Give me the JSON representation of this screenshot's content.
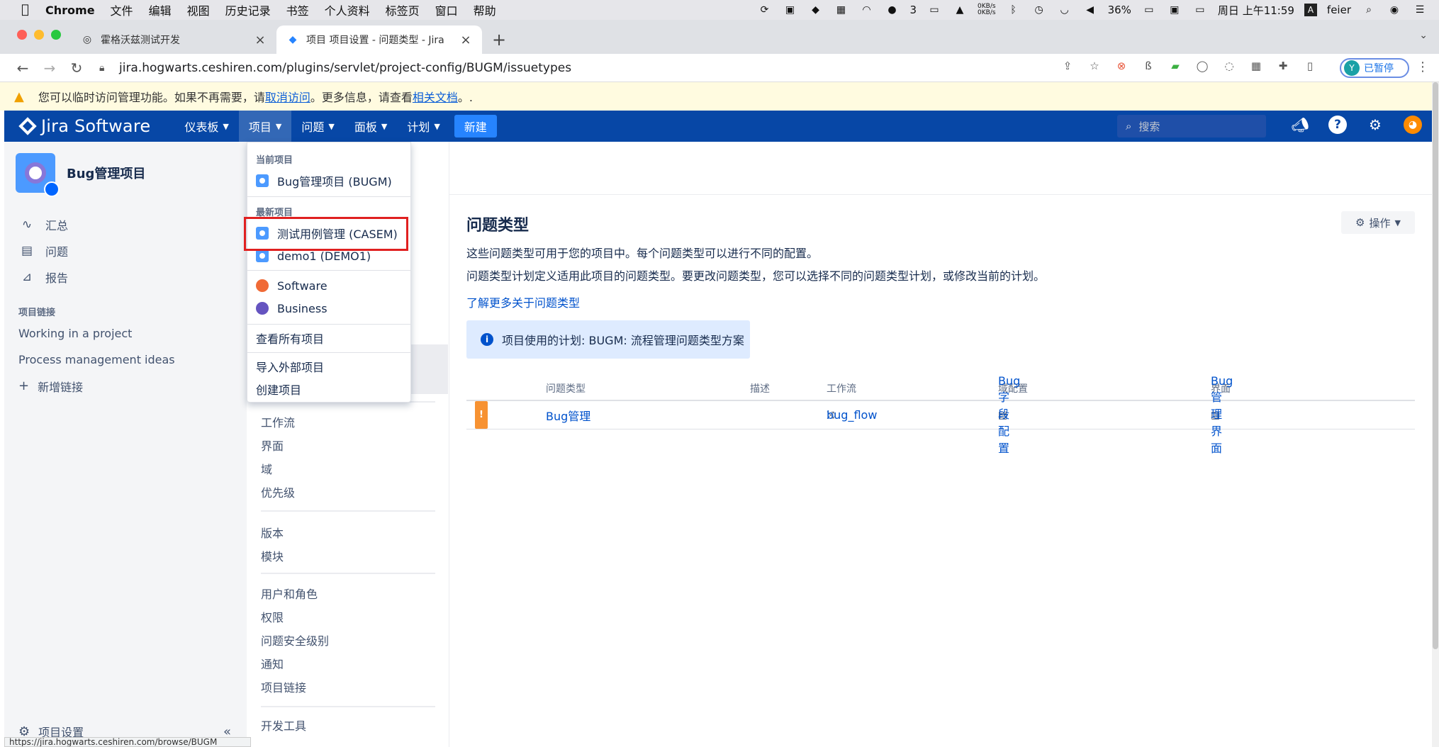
{
  "macbar": {
    "app": "Chrome",
    "menus": [
      "文件",
      "编辑",
      "视图",
      "历史记录",
      "书签",
      "个人资料",
      "标签页",
      "窗口",
      "帮助"
    ],
    "net_up": "0KB/s",
    "net_down": "0KB/s",
    "wechat_count": "3",
    "battery": "36%",
    "clock": "周日 上午11:59",
    "user": "feier"
  },
  "tabs": [
    {
      "title": "霍格沃兹测试开发"
    },
    {
      "title": "项目 项目设置 - 问题类型 - Jira"
    }
  ],
  "address": {
    "url": "jira.hogwarts.ceshiren.com/plugins/servlet/project-config/BUGM/issuetypes",
    "profile_initial": "Y",
    "profile_label": "已暂停"
  },
  "banner": {
    "text1": "您可以临时访问管理功能。如果不再需要，请",
    "link1": "取消访问",
    "text2": "。更多信息，请查看",
    "link2": "相关文档",
    "text3": "。."
  },
  "jira": {
    "logo": "Jira Software",
    "nav": [
      {
        "label": "仪表板"
      },
      {
        "label": "项目"
      },
      {
        "label": "问题"
      },
      {
        "label": "面板"
      },
      {
        "label": "计划"
      }
    ],
    "create_label": "新建",
    "search_placeholder": "搜索"
  },
  "sidebar": {
    "project_name": "Bug管理项目",
    "nav": [
      {
        "label": "汇总"
      },
      {
        "label": "问题"
      },
      {
        "label": "报告"
      }
    ],
    "links_title": "项目链接",
    "links": [
      {
        "label": "Working in a project"
      },
      {
        "label": "Process management ideas"
      }
    ],
    "add_link_label": "新增链接",
    "footer_label": "项目设置"
  },
  "settings": {
    "group1": [
      "工作流",
      "界面",
      "域",
      "优先级"
    ],
    "group2": [
      "版本",
      "模块"
    ],
    "group3": [
      "用户和角色",
      "权限",
      "问题安全级别",
      "通知",
      "项目链接"
    ],
    "group4": [
      "开发工具"
    ]
  },
  "dropdown": {
    "current_title": "当前项目",
    "current_project": "Bug管理项目 (BUGM)",
    "recent_title": "最新项目",
    "recent": [
      {
        "label": "测试用例管理 (CASEM)"
      },
      {
        "label": "demo1 (DEMO1)"
      }
    ],
    "types": [
      {
        "label": "Software",
        "color": "#f06a36"
      },
      {
        "label": "Business",
        "color": "#6554c0"
      }
    ],
    "view_all": "查看所有项目",
    "import": "导入外部项目",
    "create": "创建项目"
  },
  "main": {
    "title": "问题类型",
    "actions_label": "操作",
    "desc1": "这些问题类型可用于您的项目中。每个问题类型可以进行不同的配置。",
    "desc2": "问题类型计划定义适用此项目的问题类型。要更改问题类型，您可以选择不同的问题类型计划，或修改当前的计划。",
    "learn_more": "了解更多关于问题类型",
    "scheme_info": "项目使用的计划: BUGM: 流程管理问题类型方案",
    "columns": [
      "问题类型",
      "描述",
      "工作流",
      "域配置",
      "界面"
    ],
    "rows": [
      {
        "type": "Bug管理",
        "desc": "",
        "workflow": "bug_flow",
        "field_config": "Bug字段配置",
        "screen": "Bug管理界面"
      }
    ]
  },
  "statusbar": {
    "url": "https://jira.hogwarts.ceshiren.com/browse/BUGM"
  }
}
